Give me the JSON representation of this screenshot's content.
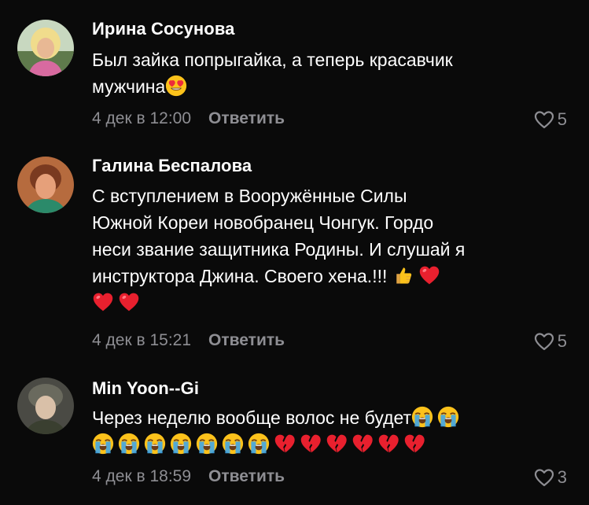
{
  "comments": [
    {
      "author": "Ирина Сосунова",
      "line1": "Был зайка попрыгайка, а теперь красавчик",
      "line2": "мужчина",
      "line2_emoji": [
        "heart-eyes"
      ],
      "timestamp": "4 дек в 12:00",
      "reply_label": "Ответить",
      "likes": "5"
    },
    {
      "author": "Галина Беспалова",
      "line1": "С вступлением в Вооружённые Силы",
      "line2": "Южной Кореи новобранец Чонгук. Гордо",
      "line3": "неси звание защитника Родины. И слушай я",
      "line4": "инструктора Джина. Своего хена.!!!",
      "line4_emoji": [
        "thumbs-up",
        "red-heart"
      ],
      "line5_emoji": [
        "red-heart",
        "red-heart"
      ],
      "timestamp": "4 дек в 15:21",
      "reply_label": "Ответить",
      "likes": "5"
    },
    {
      "author": "Min Yoon--Gi",
      "line1": "Через неделю вообще волос не будет",
      "line1_emoji": [
        "loudly-crying",
        "loudly-crying"
      ],
      "line2_emoji": [
        "loudly-crying",
        "loudly-crying",
        "loudly-crying",
        "loudly-crying",
        "loudly-crying",
        "loudly-crying",
        "loudly-crying",
        "broken-heart",
        "broken-heart",
        "broken-heart",
        "broken-heart",
        "broken-heart",
        "broken-heart"
      ],
      "timestamp": "4 дек в 18:59",
      "reply_label": "Ответить",
      "likes": "3"
    }
  ],
  "colors": {
    "background": "#0a0a0a",
    "text": "#ffffff",
    "muted": "#8e8e93",
    "heart_red": "#e8202e"
  }
}
